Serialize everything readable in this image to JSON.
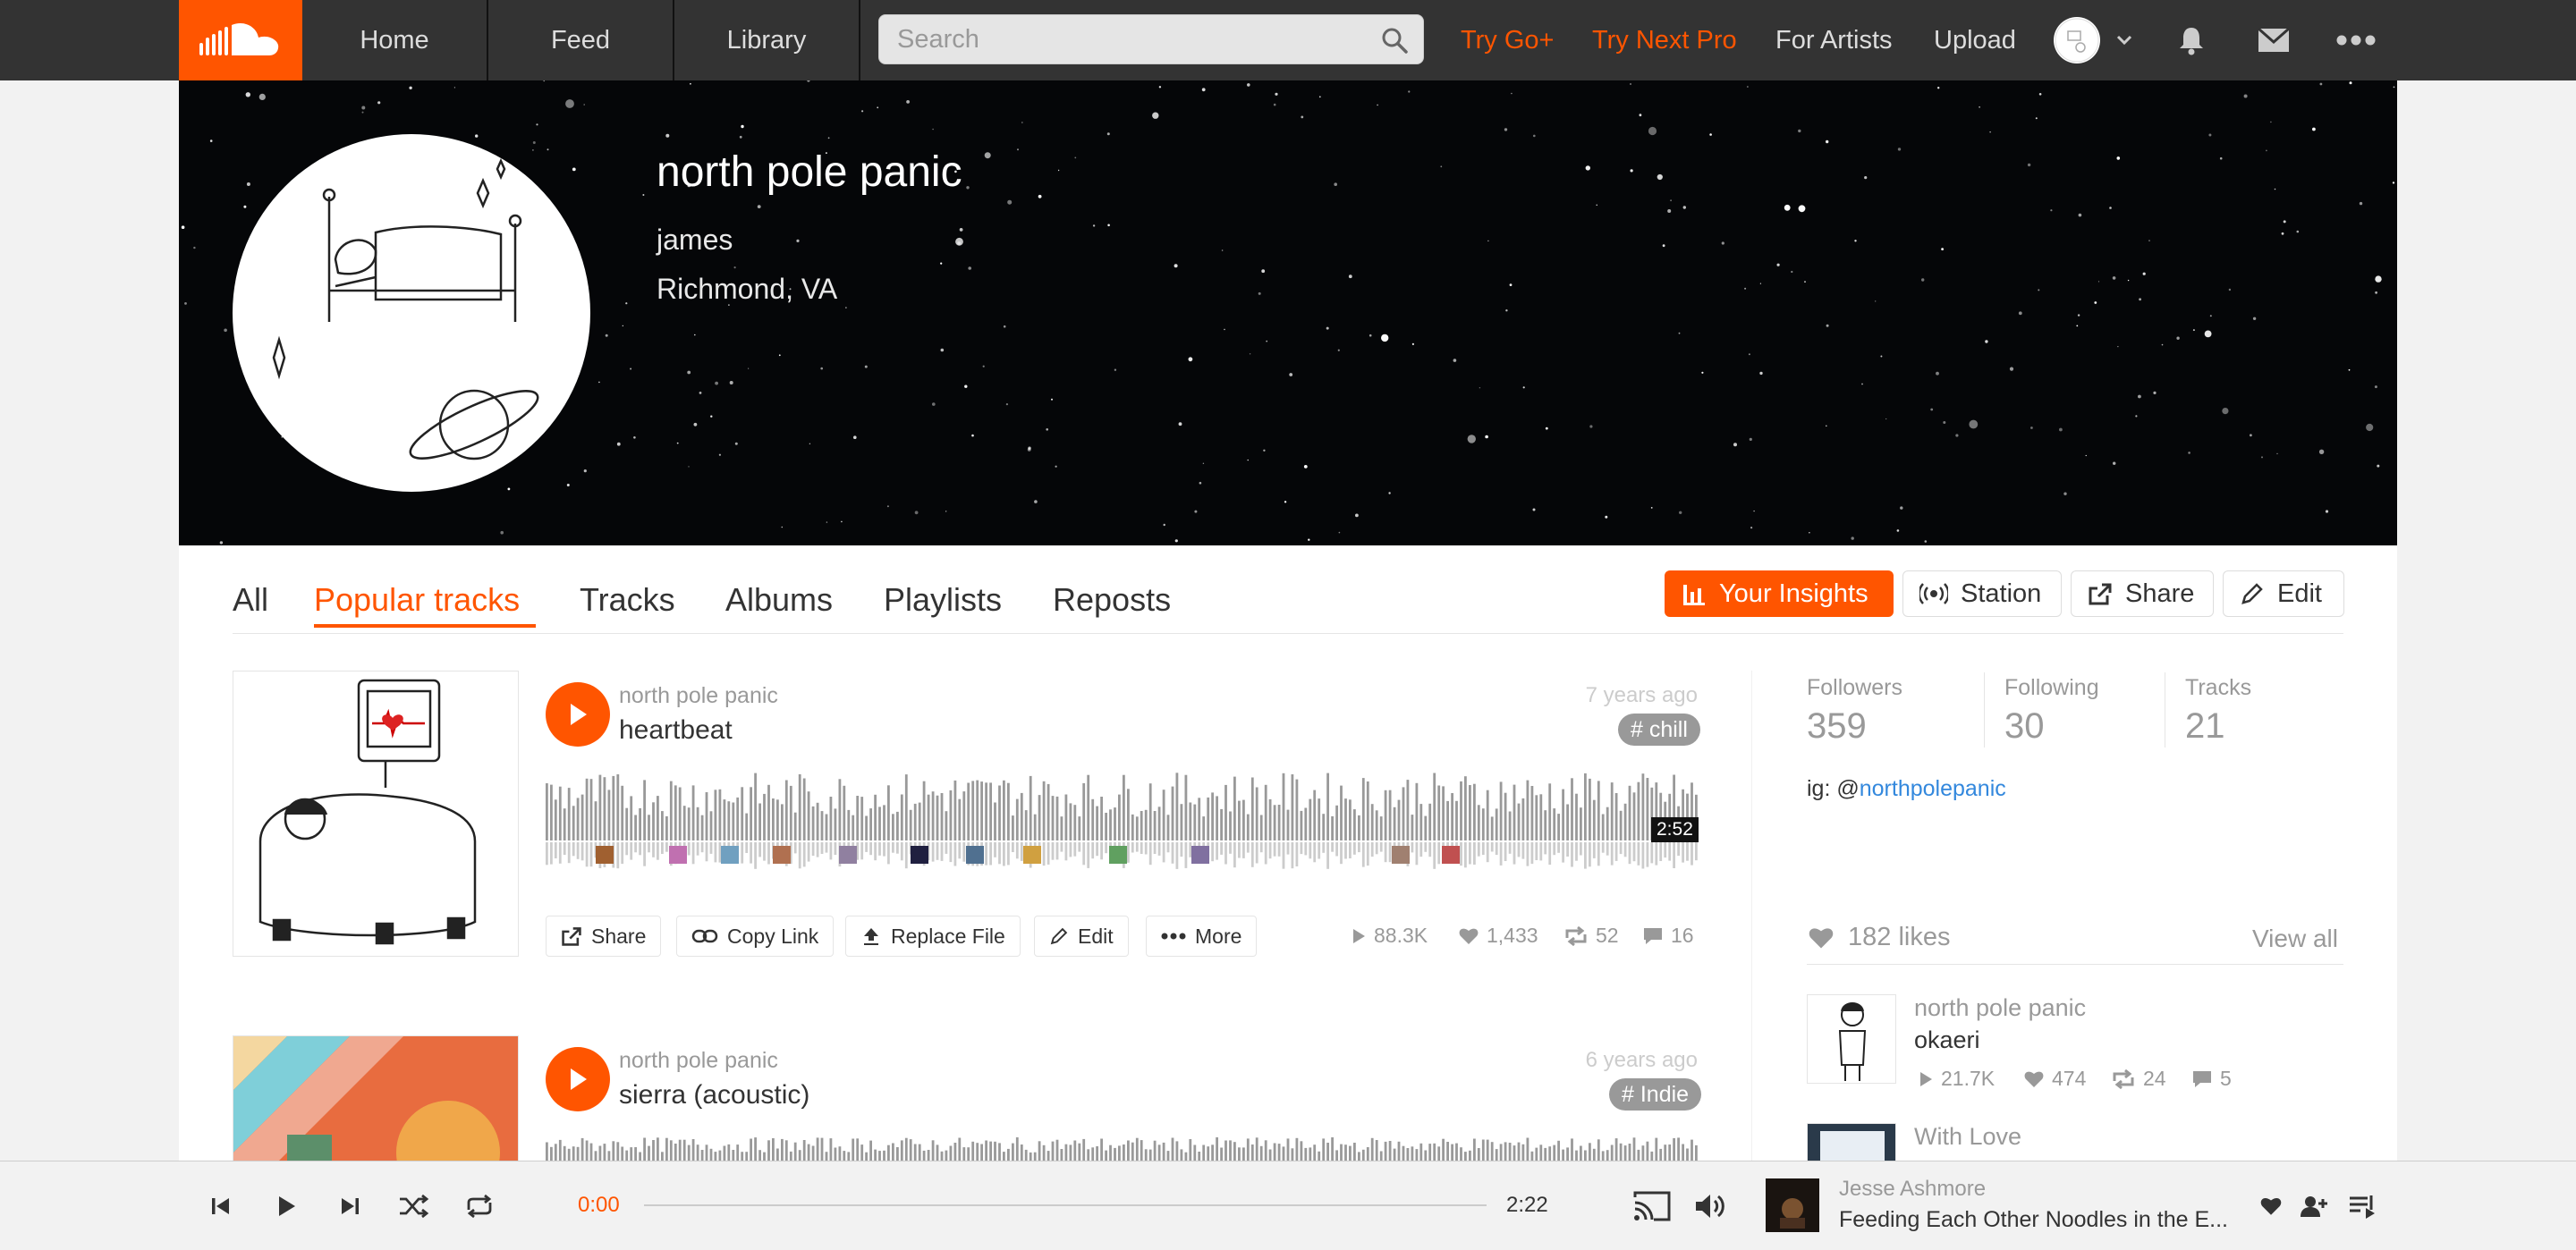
{
  "nav": {
    "home": "Home",
    "feed": "Feed",
    "library": "Library",
    "search_placeholder": "Search",
    "try_go_plus": "Try Go+",
    "try_next_pro": "Try Next Pro",
    "for_artists": "For Artists",
    "upload": "Upload"
  },
  "profile": {
    "name": "north pole panic",
    "username": "james",
    "location": "Richmond, VA"
  },
  "tabs": [
    "All",
    "Popular tracks",
    "Tracks",
    "Albums",
    "Playlists",
    "Reposts"
  ],
  "active_tab": "Popular tracks",
  "actions": {
    "insights": "Your Insights",
    "station": "Station",
    "share": "Share",
    "edit": "Edit"
  },
  "tracks": [
    {
      "artist": "north pole panic",
      "title": "heartbeat",
      "posted": "7 years ago",
      "tag": "# chill",
      "duration": "2:52",
      "plays": "88.3K",
      "likes": "1,433",
      "reposts": "52",
      "comments": "16",
      "buttons": {
        "share": "Share",
        "copy_link": "Copy Link",
        "replace_file": "Replace File",
        "edit": "Edit",
        "more": "More"
      }
    },
    {
      "artist": "north pole panic",
      "title": "sierra (acoustic)",
      "posted": "6 years ago",
      "tag": "# Indie"
    }
  ],
  "stats": {
    "followers_label": "Followers",
    "followers": "359",
    "following_label": "Following",
    "following": "30",
    "tracks_label": "Tracks",
    "tracks": "21"
  },
  "bio": {
    "prefix": "ig: @",
    "link": "northpolepanic"
  },
  "likes": {
    "count_label": "182 likes",
    "view_all": "View all",
    "items": [
      {
        "artist": "north pole panic",
        "title": "okaeri",
        "plays": "21.7K",
        "likes": "474",
        "reposts": "24",
        "comments": "5"
      },
      {
        "artist": "With Love"
      }
    ]
  },
  "player": {
    "current_time": "0:00",
    "duration": "2:22",
    "artist": "Jesse Ashmore",
    "title": "Feeding Each Other Noodles in the E...",
    "progress": 0
  },
  "colors": {
    "accent": "#ff5500",
    "nav_bg": "#333333",
    "link": "#3388dd"
  },
  "icons": [
    "soundcloud-logo-icon",
    "search-icon",
    "chevron-down-icon",
    "bell-icon",
    "mail-icon",
    "more-icon",
    "insights-icon",
    "station-icon",
    "share-icon",
    "pencil-icon",
    "play-icon",
    "link-icon",
    "upload-icon",
    "heart-icon",
    "repost-icon",
    "comment-icon",
    "previous-icon",
    "next-icon",
    "shuffle-icon",
    "repeat-icon",
    "cast-icon",
    "volume-icon",
    "follow-icon",
    "queue-icon"
  ]
}
